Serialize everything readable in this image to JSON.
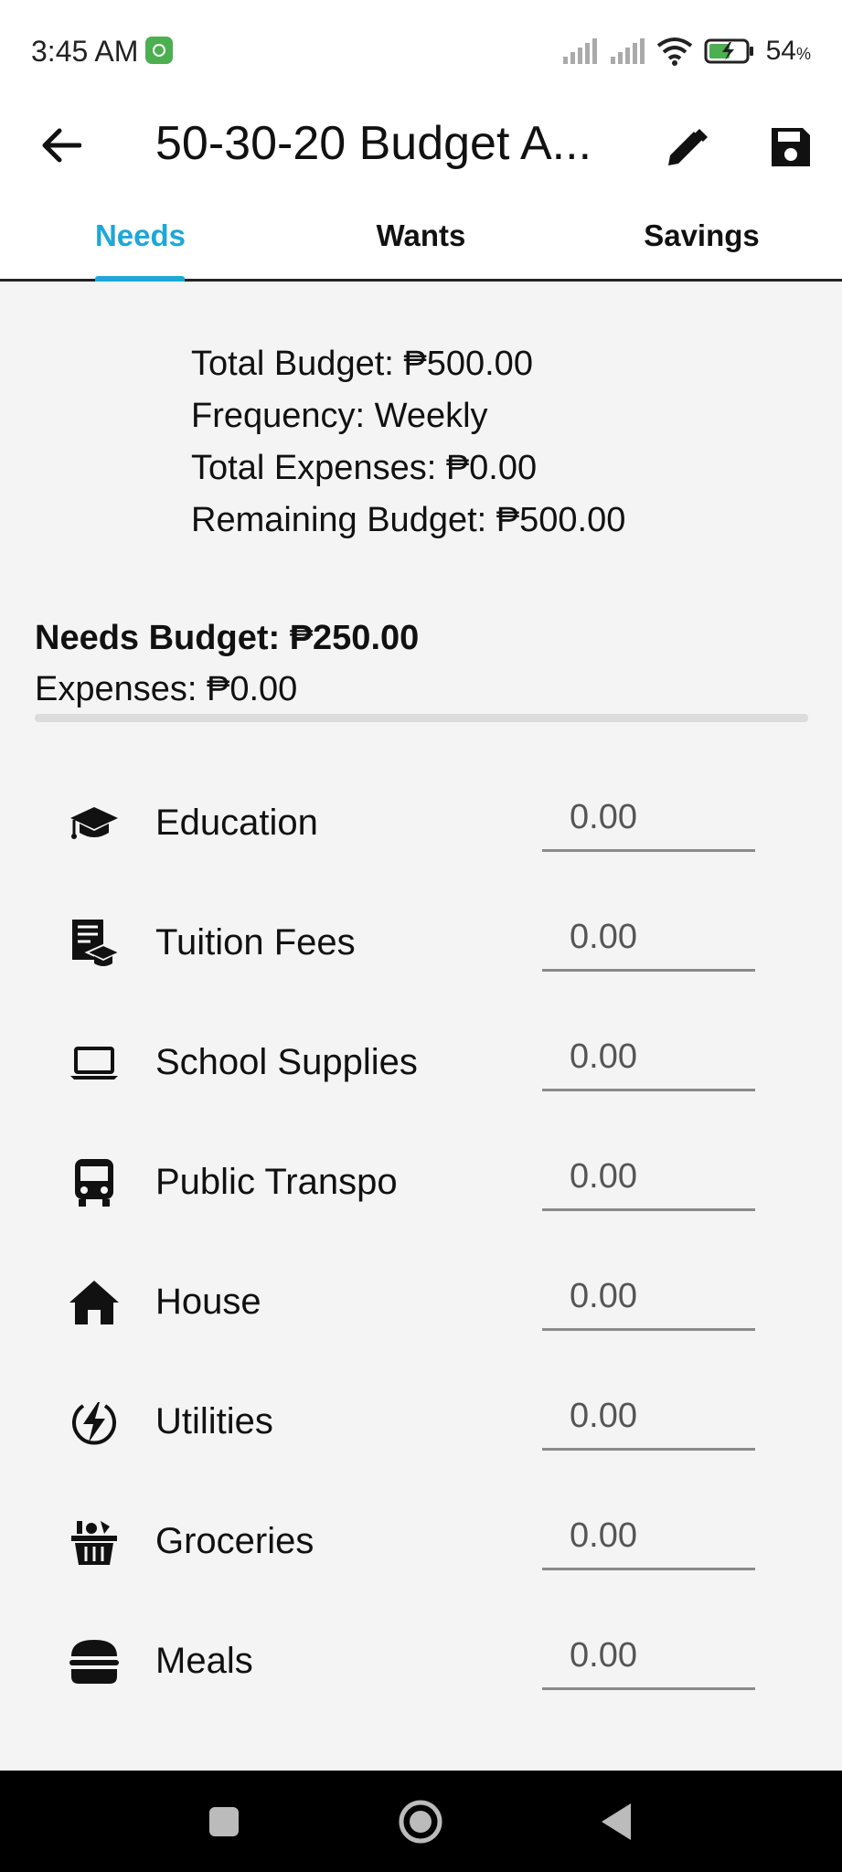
{
  "status_bar": {
    "time": "3:45 AM",
    "battery": "54",
    "battery_unit": "%",
    "icons": [
      "app-notification-icon",
      "signal-icon",
      "signal-icon",
      "wifi-icon",
      "battery-charging-icon"
    ]
  },
  "app_bar": {
    "title": "50-30-20 Budget A...",
    "back_icon": "arrow-left-icon",
    "edit_icon": "pencil-icon",
    "save_icon": "floppy-disk-icon"
  },
  "tabs": [
    {
      "label": "Needs",
      "active": true
    },
    {
      "label": "Wants",
      "active": false
    },
    {
      "label": "Savings",
      "active": false
    }
  ],
  "summary": {
    "total_budget": "Total Budget: ₱500.00",
    "frequency": "Frequency: Weekly",
    "total_expenses": "Total Expenses: ₱0.00",
    "remaining_budget": "Remaining Budget: ₱500.00"
  },
  "needs": {
    "budget": "Needs Budget: ₱250.00",
    "expenses": "Expenses: ₱0.00",
    "progress": 0
  },
  "categories": [
    {
      "label": "Education",
      "value": "0.00",
      "icon": "graduation-cap-icon"
    },
    {
      "label": "Tuition Fees",
      "value": "0.00",
      "icon": "tuition-receipt-icon"
    },
    {
      "label": "School Supplies",
      "value": "0.00",
      "icon": "laptop-icon"
    },
    {
      "label": "Public Transpo",
      "value": "0.00",
      "icon": "bus-icon"
    },
    {
      "label": "House",
      "value": "0.00",
      "icon": "house-icon"
    },
    {
      "label": "Utilities",
      "value": "0.00",
      "icon": "lightning-bolt-icon"
    },
    {
      "label": "Groceries",
      "value": "0.00",
      "icon": "grocery-basket-icon"
    },
    {
      "label": "Meals",
      "value": "0.00",
      "icon": "burger-icon"
    }
  ],
  "colors": {
    "accent": "#1ea7d8",
    "background": "#f4f4f4",
    "app_bar": "#ffffff",
    "nav_bar": "#000000"
  }
}
